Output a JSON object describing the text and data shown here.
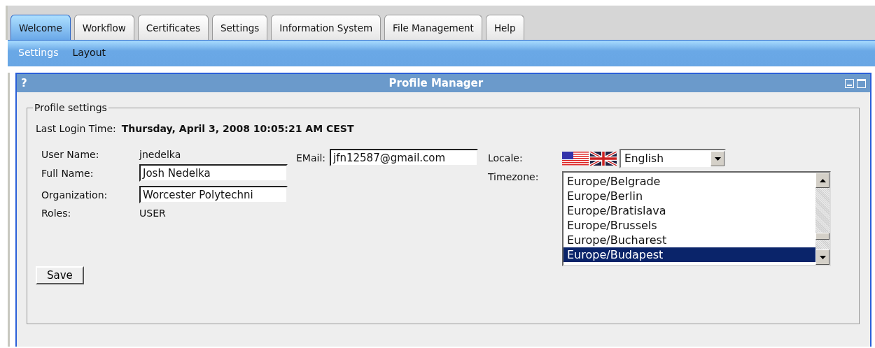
{
  "tabs": [
    {
      "label": "Welcome",
      "selected": true
    },
    {
      "label": "Workflow",
      "selected": false
    },
    {
      "label": "Certificates",
      "selected": false
    },
    {
      "label": "Settings",
      "selected": false
    },
    {
      "label": "Information System",
      "selected": false
    },
    {
      "label": "File Management",
      "selected": false
    },
    {
      "label": "Help",
      "selected": false
    }
  ],
  "subnav": [
    {
      "label": "Settings",
      "selected": true
    },
    {
      "label": "Layout",
      "selected": false
    }
  ],
  "panel": {
    "help": "?",
    "title": "Profile Manager",
    "fieldset": "Profile settings",
    "last_login": {
      "label": "Last Login Time:",
      "value": "Thursday, April 3, 2008 10:05:21 AM CEST"
    },
    "fields": [
      {
        "label": "User Name:",
        "kind": "text",
        "value": "jnedelka"
      },
      {
        "label": "Full Name:",
        "kind": "input",
        "value": "Josh Nedelka"
      },
      {
        "label": "Organization:",
        "kind": "input",
        "value": "Worcester Polytechni"
      },
      {
        "label": "Roles:",
        "kind": "text",
        "value": "USER"
      }
    ],
    "email": {
      "label": "EMail:",
      "value": "jfn12587@gmail.com"
    },
    "locale": {
      "label": "Locale:",
      "value": "English"
    },
    "timezone": {
      "label": "Timezone:",
      "options": [
        {
          "label": "Europe/Belgrade",
          "selected": false
        },
        {
          "label": "Europe/Berlin",
          "selected": false
        },
        {
          "label": "Europe/Bratislava",
          "selected": false
        },
        {
          "label": "Europe/Brussels",
          "selected": false
        },
        {
          "label": "Europe/Bucharest",
          "selected": false
        },
        {
          "label": "Europe/Budapest",
          "selected": true
        }
      ]
    },
    "save": "Save"
  }
}
